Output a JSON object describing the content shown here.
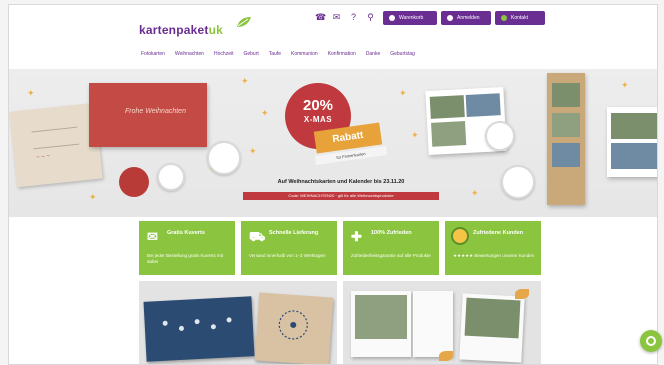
{
  "header": {
    "logo_main": "kartenpaket",
    "logo_accent": "uk",
    "icons": [
      "phone-icon",
      "mail-icon",
      "question-icon",
      "search-icon"
    ],
    "buttons": [
      {
        "label": "Warenkorb",
        "icon": "cart-icon"
      },
      {
        "label": "Anmelden",
        "icon": "user-icon"
      },
      {
        "label": "Kontakt",
        "icon": "chat-icon"
      }
    ]
  },
  "nav": {
    "items": [
      "Fotokarten",
      "Weihnachten",
      "Hochzeit",
      "Geburt",
      "Taufe",
      "Kommunion",
      "Konfirmation",
      "Danke",
      "Geburtstag"
    ]
  },
  "hero": {
    "card_script": "Frohe Weihnachten",
    "badge_percent": "20%",
    "badge_label": "X-MAS",
    "rabatt_label": "Rabatt",
    "rabatt_sub": "für Firmenkarten",
    "promo_text": "Auf Weihnachtskarten und Kalender bis 23.11.20",
    "promo_bar": "Code: WEIHNACHTEN20 · gilt für alle Weihnachtsprodukte"
  },
  "tiles": [
    {
      "title": "Gratis Kuverts",
      "desc": "Bei jeder Bestellung gratis Kuverts mit dabei",
      "icon": "envelope-icon"
    },
    {
      "title": "Schnelle Lieferung",
      "desc": "Versand innerhalb von 1–3 Werktagen",
      "icon": "truck-icon"
    },
    {
      "title": "100% Zufrieden",
      "desc": "Zufriedenheitsgarantie auf alle Produkte",
      "icon": "plus-icon"
    },
    {
      "title": "Zufriedene Kunden",
      "desc": "★★★★★ Bewertungen unserer Kunden",
      "icon": "trust-seal-icon"
    }
  ],
  "colors": {
    "brand_purple": "#6a2d91",
    "brand_green": "#8bc53f",
    "promo_red": "#c0393e",
    "accent_gold": "#e7a33a"
  }
}
